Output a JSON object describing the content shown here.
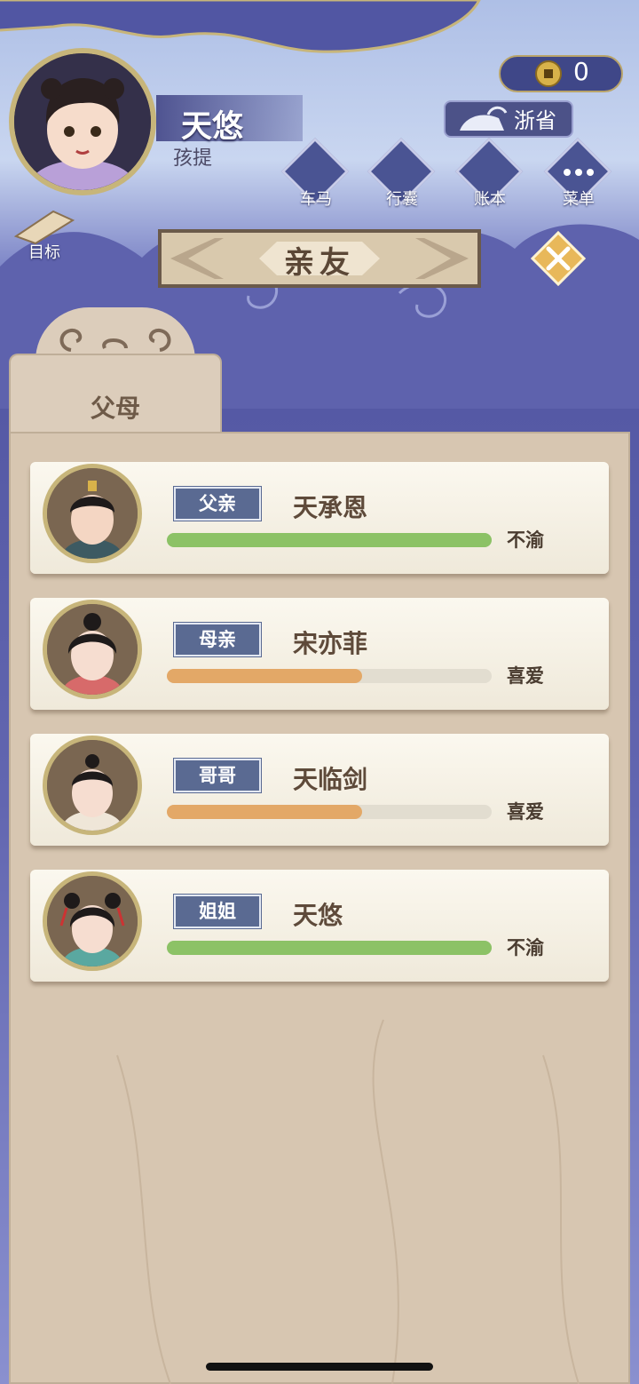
{
  "player": {
    "name": "天悠",
    "title": "孩提",
    "coins": "0",
    "province": "浙省"
  },
  "menu": [
    {
      "label": "车马",
      "icon": "carriage-icon"
    },
    {
      "label": "行囊",
      "icon": "bundle-icon"
    },
    {
      "label": "账本",
      "icon": "ledger-icon"
    },
    {
      "label": "菜单",
      "icon": "more-icon"
    }
  ],
  "goal": {
    "label": "目标",
    "icon": "scroll-icon"
  },
  "page": {
    "title": "亲友",
    "close_icon": "close-icon"
  },
  "tab": {
    "label": "父母"
  },
  "members": [
    {
      "role": "父亲",
      "name": "天承恩",
      "mood": "不渝",
      "affection": 1.0,
      "bar_color": "#8cc266"
    },
    {
      "role": "母亲",
      "name": "宋亦菲",
      "mood": "喜爱",
      "affection": 0.6,
      "bar_color": "#e3a867"
    },
    {
      "role": "哥哥",
      "name": "天临剑",
      "mood": "喜爱",
      "affection": 0.6,
      "bar_color": "#e3a867"
    },
    {
      "role": "姐姐",
      "name": "天悠",
      "mood": "不渝",
      "affection": 1.0,
      "bar_color": "#8cc266"
    }
  ],
  "colors": {
    "tag": "#5a6a92",
    "panel": "#d7c6b1",
    "accent_gold": "#c7b57a"
  }
}
